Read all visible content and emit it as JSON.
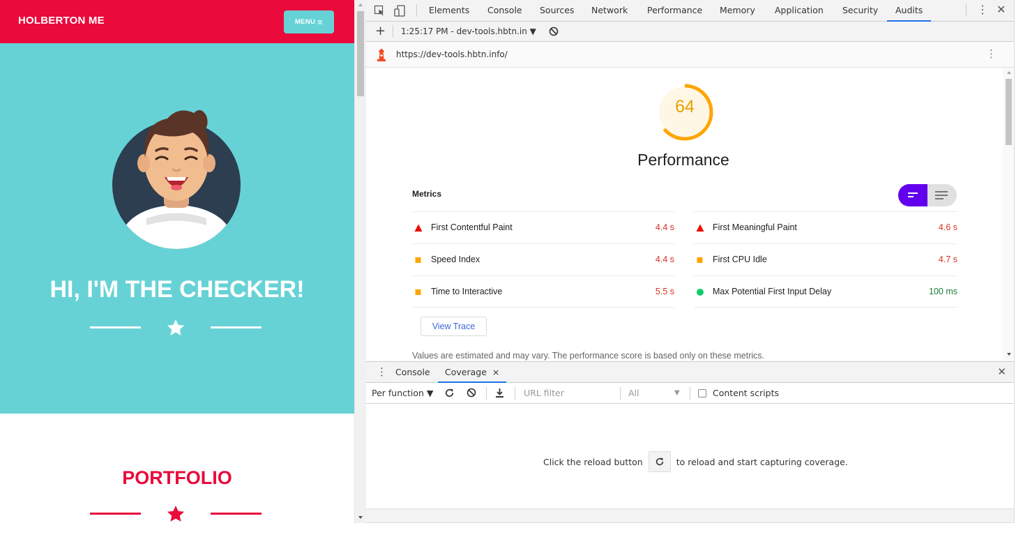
{
  "page": {
    "brand": "HOLBERTON ME",
    "menu_label": "MENU",
    "menu_icon": "hamburger-icon",
    "hero_title": "HI, I'M THE CHECKER!",
    "portfolio_title": "PORTFOLIO",
    "colors": {
      "brand_red": "#ea0a3b",
      "hero_teal": "#66d2d6",
      "avatar_bg": "#2c3e50"
    }
  },
  "devtools": {
    "tabs": [
      "Elements",
      "Console",
      "Sources",
      "Network",
      "Performance",
      "Memory",
      "Application",
      "Security",
      "Audits"
    ],
    "active_tab": "Audits",
    "session": "1:25:17 PM - dev-tools.hbtn.in ▼",
    "url": "https://dev-tools.hbtn.info/",
    "report": {
      "score": "64",
      "score_value": 64,
      "category": "Performance",
      "metrics_label": "Metrics",
      "metrics_left": [
        {
          "name": "First Contentful Paint",
          "value": "4.4 s",
          "status": "fail"
        },
        {
          "name": "Speed Index",
          "value": "4.4 s",
          "status": "average"
        },
        {
          "name": "Time to Interactive",
          "value": "5.5 s",
          "status": "average"
        }
      ],
      "metrics_right": [
        {
          "name": "First Meaningful Paint",
          "value": "4.6 s",
          "status": "fail"
        },
        {
          "name": "First CPU Idle",
          "value": "4.7 s",
          "status": "average"
        },
        {
          "name": "Max Potential First Input Delay",
          "value": "100 ms",
          "status": "pass"
        }
      ],
      "view_trace": "View Trace",
      "disclaimer": "Values are estimated and may vary. The performance score is based only on these metrics.",
      "colors": {
        "fail": "#eb0f00",
        "fail_value": "#d93025",
        "average": "#ffa400",
        "pass": "#0cce6b",
        "pass_value": "#188038",
        "toggle_active": "#6200ee"
      }
    },
    "drawer": {
      "tabs": [
        "Console",
        "Coverage"
      ],
      "active_tab": "Coverage",
      "close_glyph": "×",
      "toolbar": {
        "mode": "Per function ▼",
        "url_filter_placeholder": "URL filter",
        "type_filter": "All",
        "content_scripts": "Content scripts"
      },
      "message_before": "Click the reload button",
      "message_after": "to reload and start capturing coverage."
    }
  }
}
